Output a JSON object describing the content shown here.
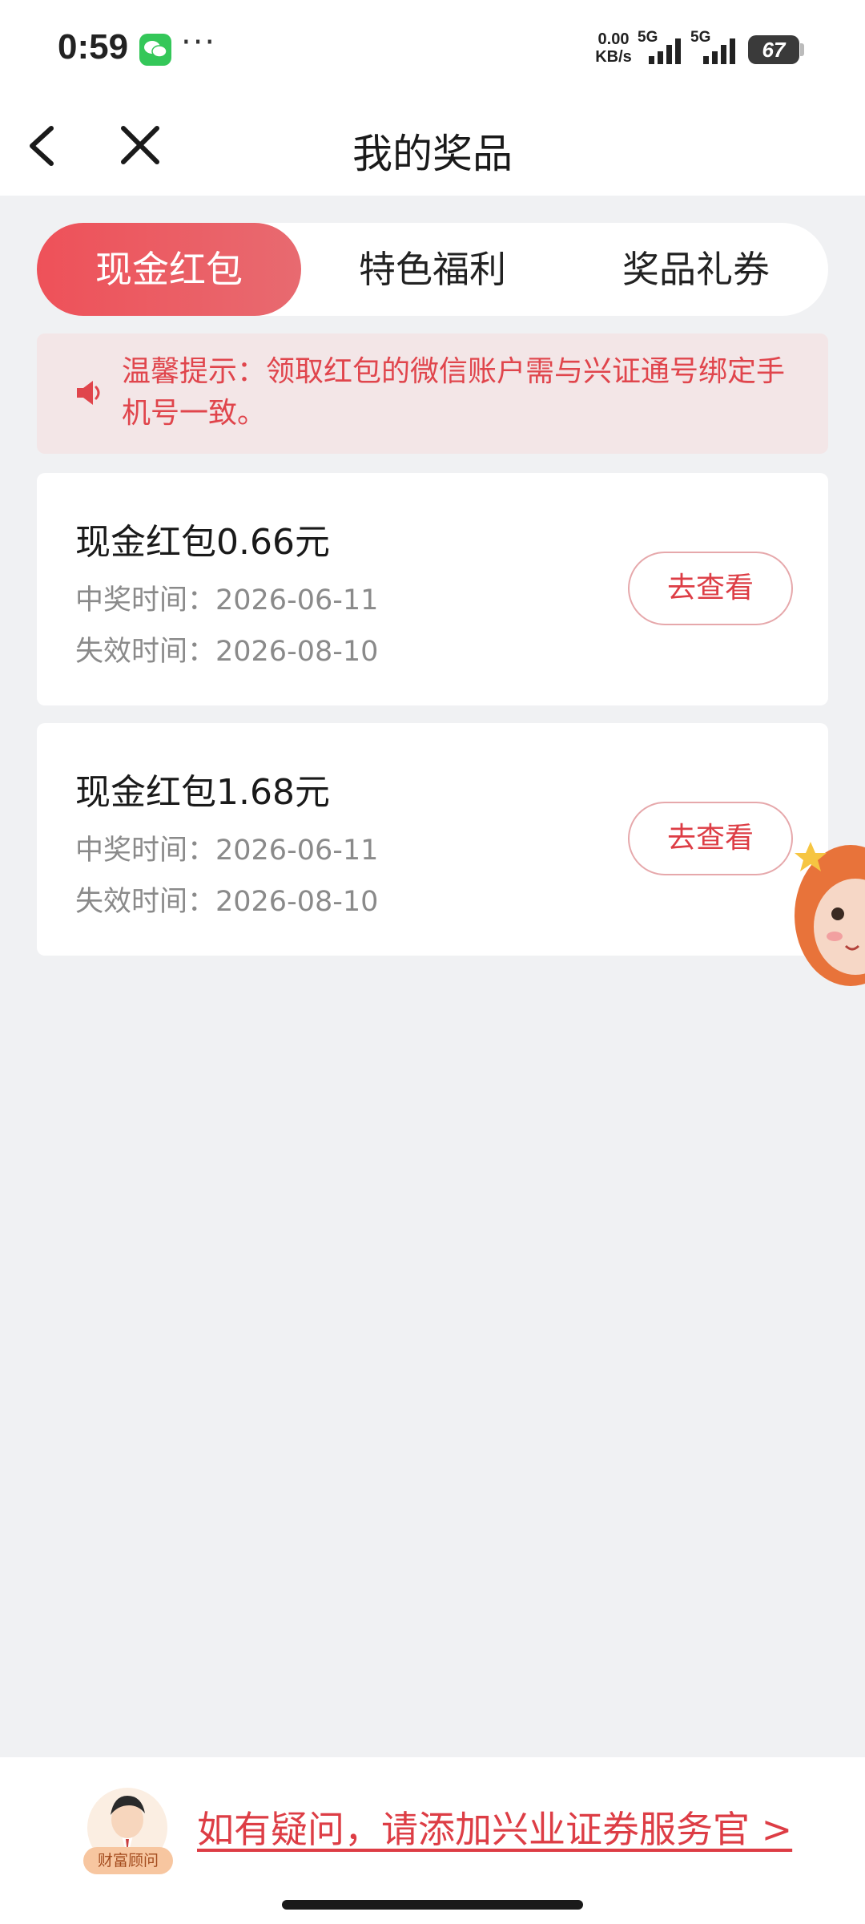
{
  "status_bar": {
    "time": "0:59",
    "more": "···",
    "net_speed_value": "0.00",
    "net_speed_unit": "KB/s",
    "sim1_label": "5G",
    "sim2_label": "5G",
    "battery": "67"
  },
  "nav": {
    "title": "我的奖品"
  },
  "tabs": [
    {
      "label": "现金红包",
      "active": true
    },
    {
      "label": "特色福利",
      "active": false
    },
    {
      "label": "奖品礼券",
      "active": false
    }
  ],
  "notice": {
    "text": "温馨提示：领取红包的微信账户需与兴证通号绑定手机号一致。"
  },
  "prizes": [
    {
      "title": "现金红包0.66元",
      "win_time": "中奖时间：2026-06-11",
      "expire_time": "失效时间：2026-08-10",
      "button": "去查看"
    },
    {
      "title": "现金红包1.68元",
      "win_time": "中奖时间：2026-06-11",
      "expire_time": "失效时间：2026-08-10",
      "button": "去查看"
    }
  ],
  "footer": {
    "advisor_badge": "财富顾问",
    "link": "如有疑问，请添加兴业证券服务官 >"
  },
  "colors": {
    "accent": "#e84f57",
    "notice_bg": "#f3e6e7",
    "page_bg": "#f0f1f3"
  },
  "icons": [
    "back-arrow-icon",
    "close-icon",
    "speaker-icon",
    "wechat-icon",
    "mascot-icon",
    "advisor-avatar-icon"
  ]
}
